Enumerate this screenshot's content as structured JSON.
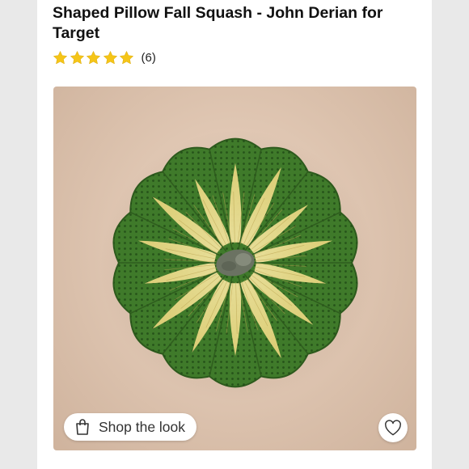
{
  "product": {
    "title": "Shaped Pillow Fall Squash - John Derian for Target",
    "rating": {
      "stars_filled": 5,
      "stars_total": 5,
      "review_count": "(6)",
      "star_color": "#f5c518"
    }
  },
  "hero": {
    "image_alt": "Shaped Pillow Fall Squash",
    "shop_the_look_label": "Shop the look",
    "shop_icon": "shopping-bag-icon",
    "favorite_icon": "heart-icon"
  },
  "colors": {
    "background": "#e9e9e9",
    "card": "#ffffff",
    "photo_backdrop": "#dfc6b2",
    "squash_green": "#3f7a2a",
    "squash_yellow": "#eadb8c",
    "stem": "#6b7262"
  }
}
